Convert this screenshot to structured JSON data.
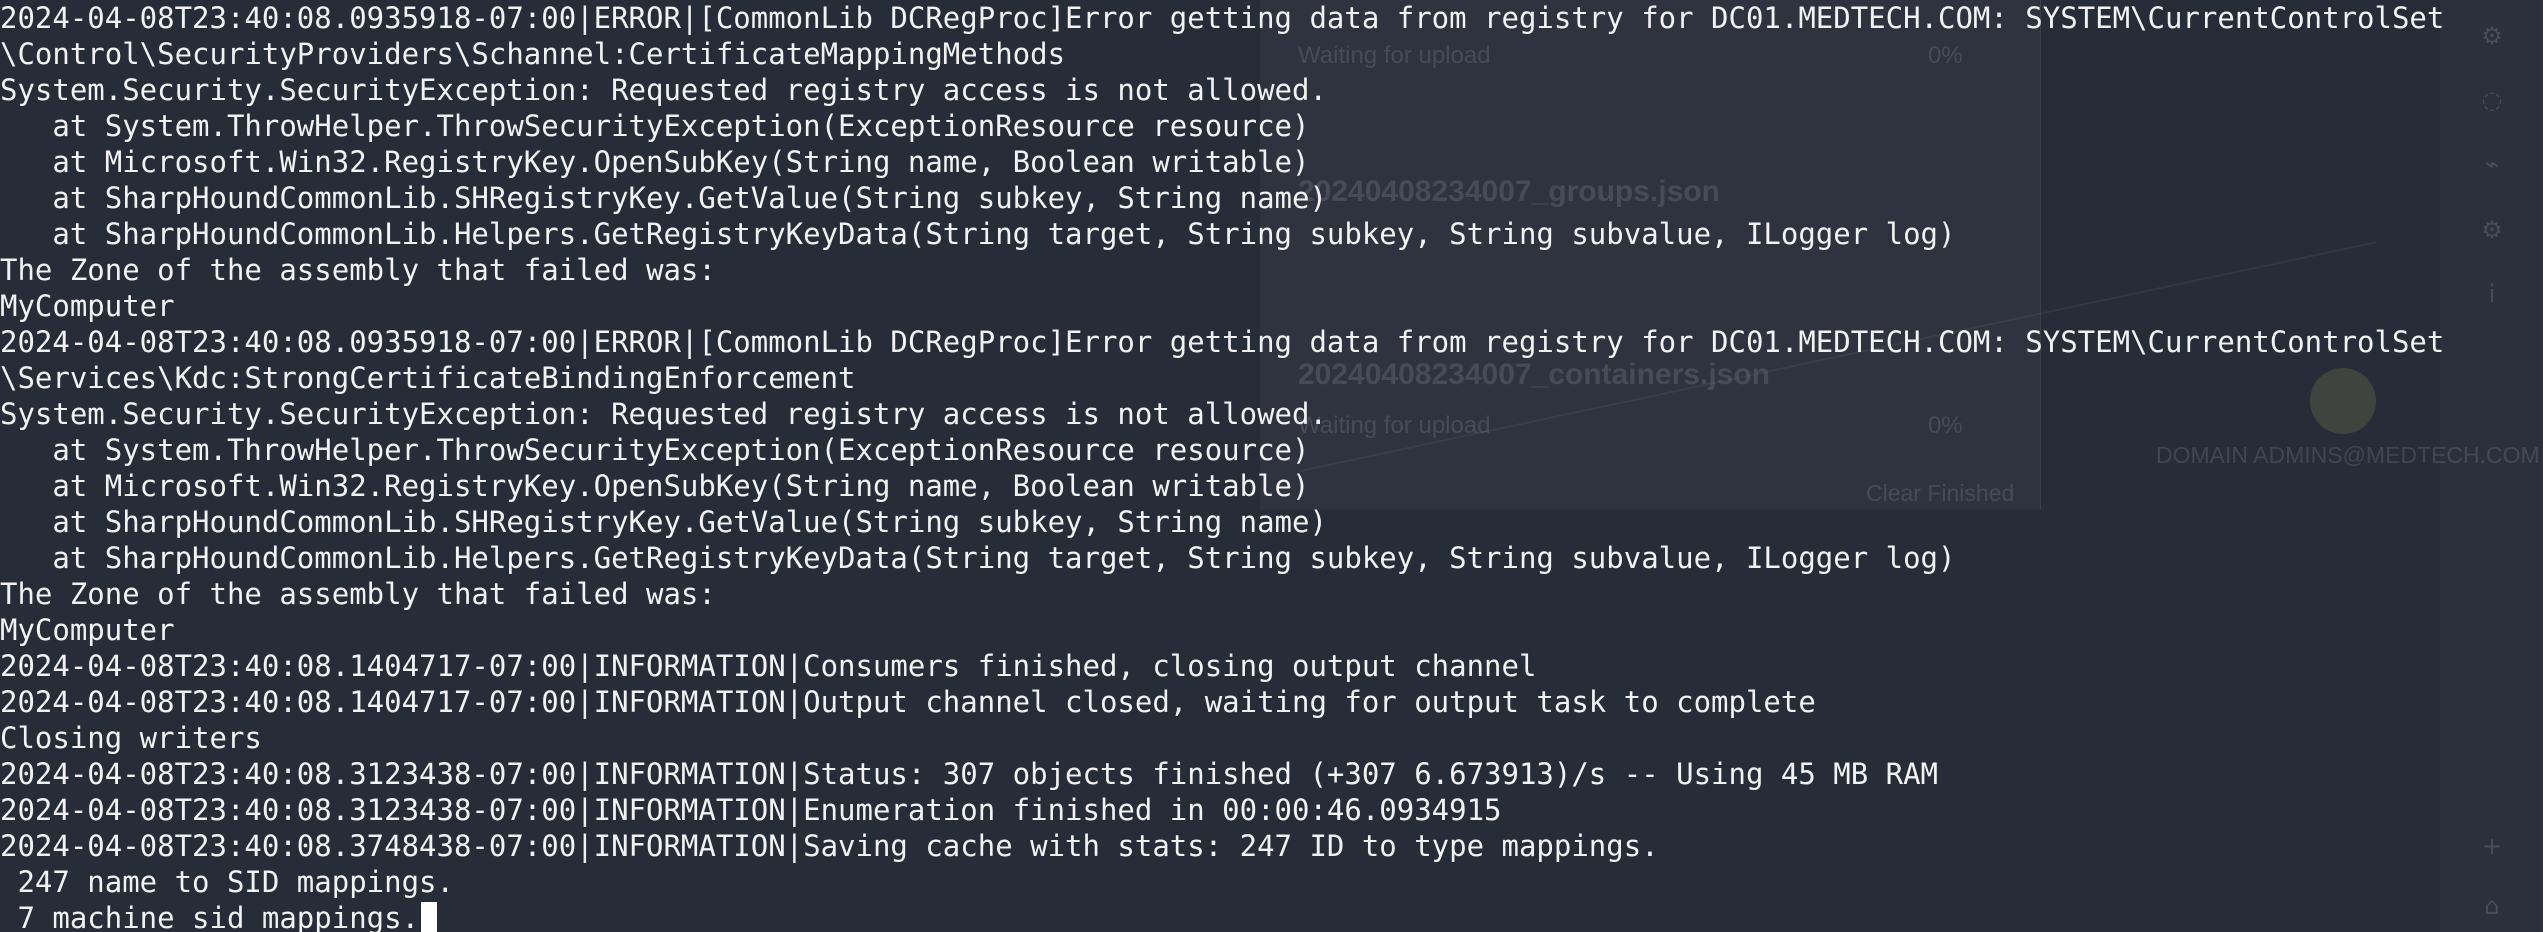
{
  "background_app": {
    "upload_items": [
      {
        "status": "Waiting for upload",
        "progress": "0%"
      },
      {
        "filename": "20240408234007_groups.json"
      },
      {
        "filename": "20240408234007_containers.json",
        "status": "Waiting for upload",
        "progress": "0%"
      }
    ],
    "clear_finished_label": "Clear Finished",
    "node_label": "DOMAIN ADMINS@MEDTECH.COM",
    "sidebar_icons": [
      "gear-icon",
      "spinner-icon",
      "chart-icon",
      "settings-icon",
      "info-icon",
      "plus-icon",
      "home-icon"
    ]
  },
  "terminal": {
    "lines": [
      "2024-04-08T23:40:08.0935918-07:00|ERROR|[CommonLib DCRegProc]Error getting data from registry for DC01.MEDTECH.COM: SYSTEM\\CurrentControlSet",
      "\\Control\\SecurityProviders\\Schannel:CertificateMappingMethods",
      "System.Security.SecurityException: Requested registry access is not allowed.",
      "   at System.ThrowHelper.ThrowSecurityException(ExceptionResource resource)",
      "   at Microsoft.Win32.RegistryKey.OpenSubKey(String name, Boolean writable)",
      "   at SharpHoundCommonLib.SHRegistryKey.GetValue(String subkey, String name)",
      "   at SharpHoundCommonLib.Helpers.GetRegistryKeyData(String target, String subkey, String subvalue, ILogger log)",
      "The Zone of the assembly that failed was:",
      "MyComputer",
      "2024-04-08T23:40:08.0935918-07:00|ERROR|[CommonLib DCRegProc]Error getting data from registry for DC01.MEDTECH.COM: SYSTEM\\CurrentControlSet",
      "\\Services\\Kdc:StrongCertificateBindingEnforcement",
      "System.Security.SecurityException: Requested registry access is not allowed.",
      "   at System.ThrowHelper.ThrowSecurityException(ExceptionResource resource)",
      "   at Microsoft.Win32.RegistryKey.OpenSubKey(String name, Boolean writable)",
      "   at SharpHoundCommonLib.SHRegistryKey.GetValue(String subkey, String name)",
      "   at SharpHoundCommonLib.Helpers.GetRegistryKeyData(String target, String subkey, String subvalue, ILogger log)",
      "The Zone of the assembly that failed was:",
      "MyComputer",
      "2024-04-08T23:40:08.1404717-07:00|INFORMATION|Consumers finished, closing output channel",
      "2024-04-08T23:40:08.1404717-07:00|INFORMATION|Output channel closed, waiting for output task to complete",
      "Closing writers",
      "2024-04-08T23:40:08.3123438-07:00|INFORMATION|Status: 307 objects finished (+307 6.673913)/s -- Using 45 MB RAM",
      "2024-04-08T23:40:08.3123438-07:00|INFORMATION|Enumeration finished in 00:00:46.0934915",
      "2024-04-08T23:40:08.3748438-07:00|INFORMATION|Saving cache with stats: 247 ID to type mappings.",
      " 247 name to SID mappings.",
      " 7 machine sid mappings."
    ]
  },
  "colors": {
    "background": "#272c39",
    "text": "#f2f2f2",
    "cursor": "#ffffff"
  }
}
